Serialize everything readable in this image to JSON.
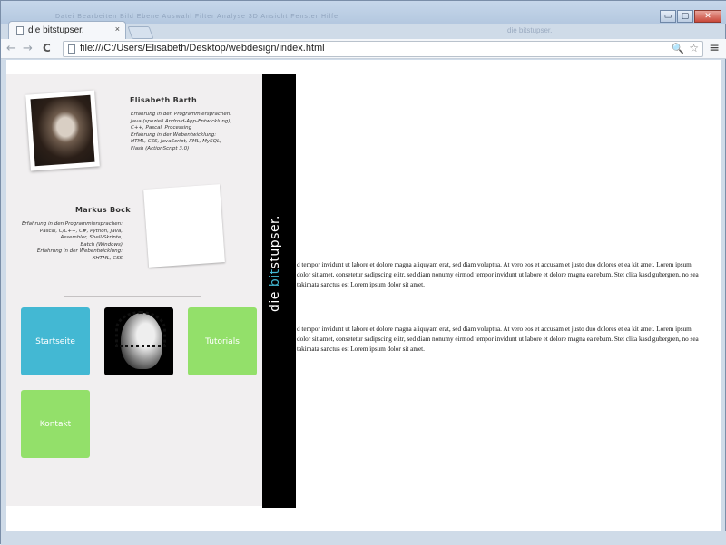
{
  "window": {
    "ghost_menu": "Datei  Bearbeiten  Bild  Ebene  Auswahl  Filter  Analyse  3D  Ansicht  Fenster  Hilfe",
    "ghost_title": "die bitstupser.",
    "controls": {
      "minimize": "▭",
      "maximize": "▢",
      "close": "✕"
    }
  },
  "tab": {
    "title": "die bitstupser.",
    "close": "×"
  },
  "toolbar": {
    "back": "←",
    "forward": "→",
    "reload": "C",
    "url": "file:///C:/Users/Elisabeth/Desktop/webdesign/index.html",
    "zoom_icon": "🔍",
    "star_icon": "☆",
    "menu_icon": "≡"
  },
  "sidebar": {
    "person1": {
      "name": "Elisabeth Barth",
      "desc": "Erfahrung in den Programmiersprachen:\nJava (speziell Android-App-Entwicklung),\nC++, Pascal, Processing\nErfahrung in der Webentwicklung:\nHTML, CSS, JavaScript, XML, MySQL,\nFlash (ActionScript 3.0)"
    },
    "person2": {
      "name": "Markus Bock",
      "desc": "Erfahrung in den Programmiersprachen:\nPascal, C/C++, C#, Python, Java,\nAssembler, Shell-Skripte,\nBatch (Windows)\nErfahrung in der Webentwicklung:\nXHTML, CSS"
    },
    "tiles": {
      "start": "Startseite",
      "tutorials": "Tutorials",
      "kontakt": "Kontakt"
    }
  },
  "brand": {
    "prefix": "die ",
    "accent": "bit",
    "rest": "stupser."
  },
  "content": {
    "para1": "d tempor invidunt ut labore et dolore magna aliquyam erat, sed diam voluptua. At vero eos et accusam et justo duo dolores et ea kit amet. Lorem ipsum dolor sit amet, consetetur sadipscing elitr, sed diam nonumy eirmod tempor invidunt ut labore et dolore magna ea rebum. Stet clita kasd gubergren, no sea takimata sanctus est Lorem ipsum dolor sit amet.",
    "para2": "d tempor invidunt ut labore et dolore magna aliquyam erat, sed diam voluptua. At vero eos et accusam et justo duo dolores et ea kit amet. Lorem ipsum dolor sit amet, consetetur sadipscing elitr, sed diam nonumy eirmod tempor invidunt ut labore et dolore magna ea rebum. Stet clita kasd gubergren, no sea takimata sanctus est Lorem ipsum dolor sit amet."
  },
  "colors": {
    "accent_blue": "#43b8d3",
    "accent_green": "#93e06a",
    "bar": "#000000"
  }
}
